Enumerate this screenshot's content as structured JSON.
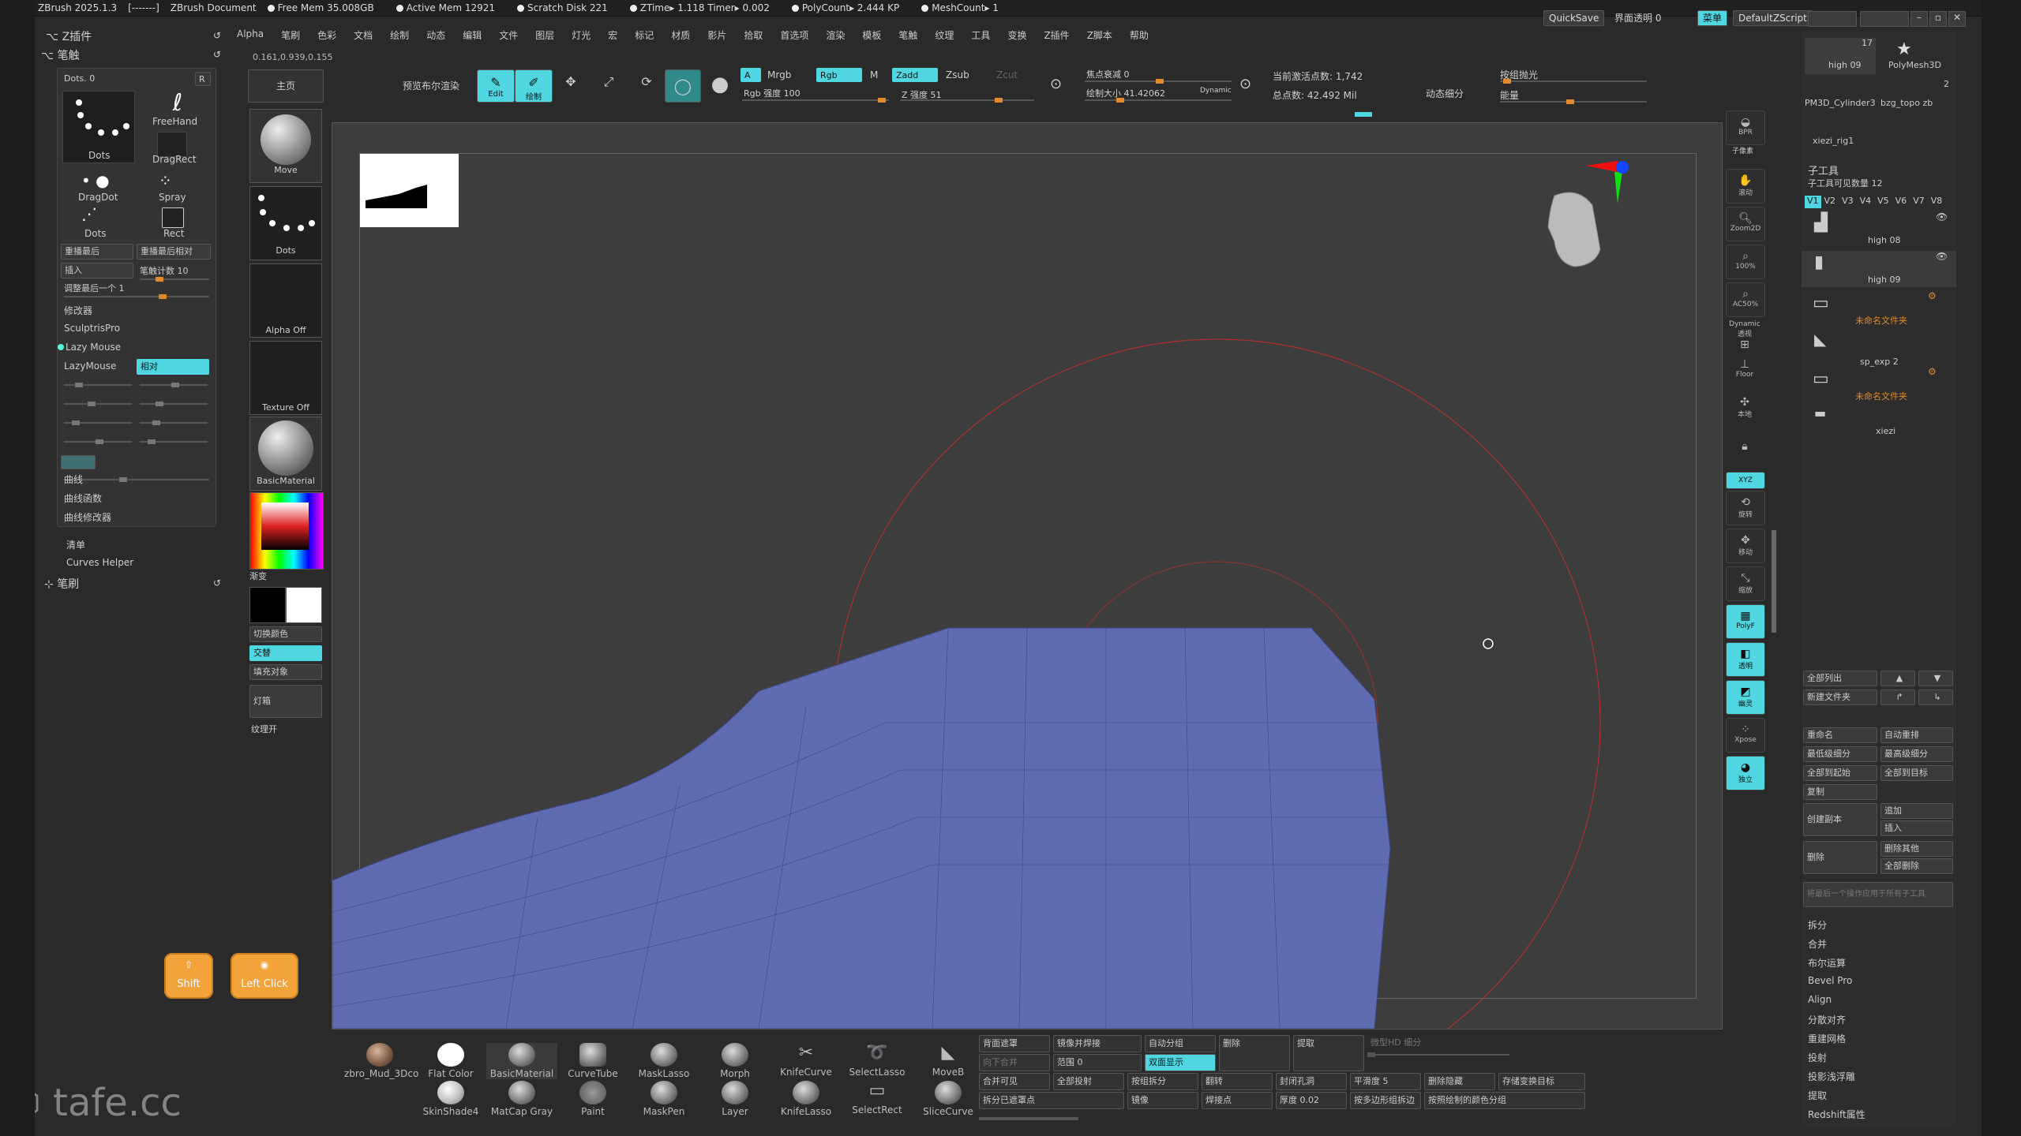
{
  "titlebar": {
    "app": "ZBrush 2025.1.3",
    "brackets": "[-------]",
    "doc": "ZBrush Document",
    "free_mem": "Free Mem 35.008GB",
    "active_mem": "Active Mem 12921",
    "scratch": "Scratch Disk 221",
    "timer": "ZTime▸ 1.118 Timer▸ 0.002",
    "polycount": "PolyCount▸ 2.444 KP",
    "meshcount": "MeshCount▸ 1",
    "quicksave": "QuickSave",
    "interface_transparency": "界面透明 0",
    "menus": "菜单",
    "default_zscript": "DefaultZScript"
  },
  "menubar": [
    "Alpha",
    "笔刷",
    "色彩",
    "文档",
    "绘制",
    "动态",
    "编辑",
    "文件",
    "图层",
    "灯光",
    "宏",
    "标记",
    "材质",
    "影片",
    "拾取",
    "首选项",
    "渲染",
    "模板",
    "笔触",
    "纹理",
    "工具",
    "变换",
    "Z插件",
    "Z脚本",
    "帮助"
  ],
  "left": {
    "zplugin": "Z插件",
    "stroke": "笔触",
    "coords": "0.161,0.939,0.155",
    "dots_label": "Dots. 0",
    "r_btn": "R",
    "strokes": [
      {
        "name": "Dots"
      },
      {
        "name": "FreeHand"
      },
      {
        "name": "DragRect"
      },
      {
        "name": "DragDot"
      },
      {
        "name": "Spray"
      },
      {
        "name": "Dots"
      },
      {
        "name": "Rect"
      }
    ],
    "btn_replay_last": "重播最后",
    "btn_replay_last_rel": "重播最后相对",
    "btn_insert": "插入",
    "stroke_count": "笔触计数 10",
    "adjust_last": "调整最后一个 1",
    "modifiers": "修改器",
    "sculptris": "SculptrisPro",
    "lazymouse_toggle": "Lazy Mouse",
    "lazymouse_label": "LazyMouse",
    "lazymouse_mode": "相对",
    "curve": "曲线",
    "curve_func": "曲线函数",
    "curve_mod": "曲线修改器",
    "clear": "清单",
    "curves_helper": "Curves Helper",
    "brush": "笔刷",
    "shift": "Shift",
    "left_click": "Left Click"
  },
  "shelf": {
    "home": "主页",
    "move": "Move",
    "dots": "Dots",
    "alpha_off": "Alpha Off",
    "texture_off": "Texture Off",
    "material": "BasicMaterial",
    "gradient": "渐变",
    "switch_color": "切换颜色",
    "alternate": "交替",
    "fill_object": "填充对象",
    "light": "灯箱",
    "texture_on": "纹理开"
  },
  "toolbar": {
    "preview_bool": "预览布尔渲染",
    "edit": "Edit",
    "draw": "绘制",
    "a": "A",
    "mrgb": "Mrgb",
    "rgb": "Rgb",
    "m": "M",
    "zadd": "Zadd",
    "zsub": "Zsub",
    "zcut": "Zcut",
    "rgb_intensity": "Rgb 强度 100",
    "z_intensity": "Z 强度 51",
    "focal_shift": "焦点衰减 0",
    "draw_size": "绘制大小 41.42062",
    "dynamic": "Dynamic",
    "active_points": "当前激活点数: 1,742",
    "total_points": "总点数: 42.492 Mil",
    "dyn_subdiv": "动态细分",
    "by_polygroup": "按组抛光",
    "energy": "能量"
  },
  "right_panel": {
    "subtool": "子工具",
    "visible_count": "子工具可见数量 12",
    "versions": [
      "V1",
      "V2",
      "V3",
      "V4",
      "V5",
      "V6",
      "V7",
      "V8"
    ],
    "items": [
      {
        "name": "high 08"
      },
      {
        "name": "high 09"
      },
      {
        "name": "未命名文件夹"
      },
      {
        "name": "sp_exp 2"
      },
      {
        "name": "未命名文件夹"
      },
      {
        "name": "xiezi"
      }
    ],
    "top_items": [
      "high 09",
      "PolyMesh3D",
      "PM3D_Cylinder3",
      "bzg_topo zb",
      "xiezi_rig1"
    ],
    "top_count1": "17",
    "top_count2": "2",
    "list_all": "全部列出",
    "new_folder": "新建文件夹",
    "rename": "重命名",
    "auto_sort": "自动重排",
    "lowest_subdiv": "最低级细分",
    "highest_subdiv": "最高级细分",
    "all_to_low": "全部到起始",
    "all_to_high": "全部到目标",
    "duplicate": "复制",
    "create_copy": "创建副本",
    "append": "追加",
    "insert": "插入",
    "delete": "删除",
    "delete_others": "删除其他",
    "delete_all": "全部删除",
    "merge_note": "将最后一个操作应用于所有子工具",
    "menu": [
      "拆分",
      "合并",
      "布尔运算",
      "Bevel Pro",
      "Align",
      "分散对齐",
      "重建网格",
      "投射",
      "投影浅浮雕",
      "提取",
      "Redshift属性"
    ]
  },
  "right_strip": [
    "BPR",
    "子像素",
    "滚动",
    "Zoom2D",
    "100%",
    "AC50%",
    "Dynamic 透视",
    "Floor",
    "本地",
    "XYZ",
    "旋转",
    "移动",
    "缩放",
    "PolyF",
    "透明",
    "幽灵",
    "Xpose",
    "独立"
  ],
  "bottom": {
    "icons": [
      "zbro_Mud_3Dco",
      "Flat Color",
      "BasicMaterial",
      "CurveTube",
      "MaskLasso",
      "Morph",
      "KnifeCurve",
      "SelectLasso",
      "MoveB",
      "SkinShade4",
      "MatCap Gray",
      "Paint",
      "MaskPen",
      "Layer",
      "KnifeLasso",
      "SelectRect",
      "SliceCurve"
    ],
    "btns": {
      "back_mask": "背面遮罩",
      "mirror_weld": "镜像并焊接",
      "auto_group": "自动分组",
      "delete": "删除",
      "extract": "提取",
      "micro": "微型HD 细分",
      "down": "向下合并",
      "range": "范围 0",
      "double": "双面显示",
      "merge_visible": "合并可见",
      "all_project": "全部投射",
      "group_split": "按组拆分",
      "flip": "翻转",
      "close_holes": "封闭孔洞",
      "smooth": "平滑度 5",
      "delete_hidden": "删除隐藏",
      "store_target": "存储变换目标",
      "split_masked": "拆分已遮罩点",
      "mirror": "镜像",
      "weld_points": "焊接点",
      "thickness": "厚度 0.02",
      "by_poly_split": "按多边形组拆边",
      "by_color_group": "按照绘制的颜色分组"
    }
  },
  "watermark": "tafe.cc"
}
